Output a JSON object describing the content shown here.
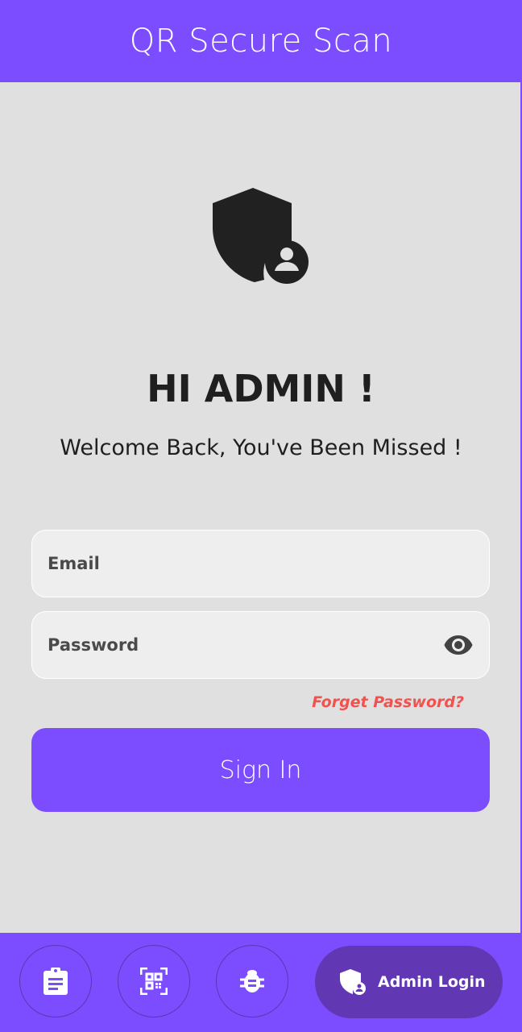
{
  "app": {
    "title": "QR Secure Scan"
  },
  "colors": {
    "primary": "#7c4dff",
    "active_nav": "#6237b3",
    "link": "#ef5350",
    "background": "#e0e0e0"
  },
  "login": {
    "icon": "admin-shield-icon",
    "greeting": "HI ADMIN !",
    "subtitle": "Welcome Back, You've Been Missed !",
    "email": {
      "placeholder": "Email",
      "value": ""
    },
    "password": {
      "placeholder": "Password",
      "value": "",
      "toggle_icon": "eye-icon"
    },
    "forgot_label": "Forget Password?",
    "signin_label": "Sign In"
  },
  "bottom_nav": {
    "items": [
      {
        "icon": "clipboard-icon"
      },
      {
        "icon": "qr-scan-icon"
      },
      {
        "icon": "bug-icon"
      },
      {
        "icon": "admin-shield-icon",
        "label": "Admin Login",
        "active": true
      }
    ]
  }
}
